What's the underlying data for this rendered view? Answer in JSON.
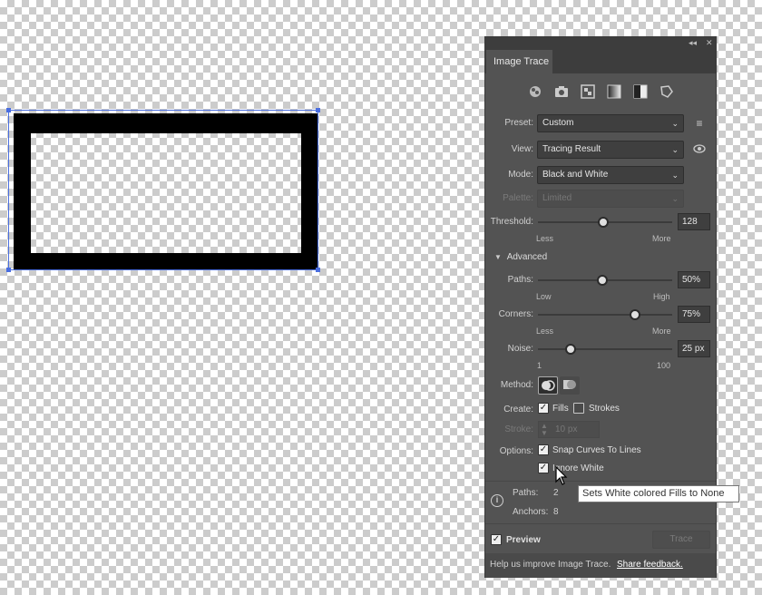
{
  "panel": {
    "tab_title": "Image Trace",
    "preset_label": "Preset:",
    "preset_value": "Custom",
    "view_label": "View:",
    "view_value": "Tracing Result",
    "mode_label": "Mode:",
    "mode_value": "Black and White",
    "palette_label": "Palette:",
    "palette_value": "Limited",
    "threshold_label": "Threshold:",
    "threshold_value": "128",
    "threshold_min": "Less",
    "threshold_max": "More",
    "advanced_label": "Advanced",
    "paths_label": "Paths:",
    "paths_value": "50%",
    "paths_min": "Low",
    "paths_max": "High",
    "corners_label": "Corners:",
    "corners_value": "75%",
    "corners_min": "Less",
    "corners_max": "More",
    "noise_label": "Noise:",
    "noise_value": "25 px",
    "noise_min": "1",
    "noise_max": "100",
    "method_label": "Method:",
    "create_label": "Create:",
    "fills_label": "Fills",
    "strokes_label": "Strokes",
    "stroke_label": "Stroke:",
    "stroke_value": "10 px",
    "options_label": "Options:",
    "snap_label": "Snap Curves To Lines",
    "ignore_white_label": "Ignore White",
    "info_paths_label": "Paths:",
    "info_paths_value": "2",
    "info_anchors_label": "Anchors:",
    "info_anchors_value": "8",
    "preview_label": "Preview",
    "trace_button": "Trace",
    "footer_text": "Help us improve Image Trace.",
    "footer_link": "Share feedback."
  },
  "tooltip": "Sets White colored Fills to None",
  "icons": [
    "auto-color-icon",
    "high-color-icon",
    "low-color-icon",
    "grayscale-icon",
    "black-white-icon",
    "outline-icon"
  ],
  "colors": {
    "panel_bg": "#535353",
    "selection": "#4a6ee0"
  }
}
